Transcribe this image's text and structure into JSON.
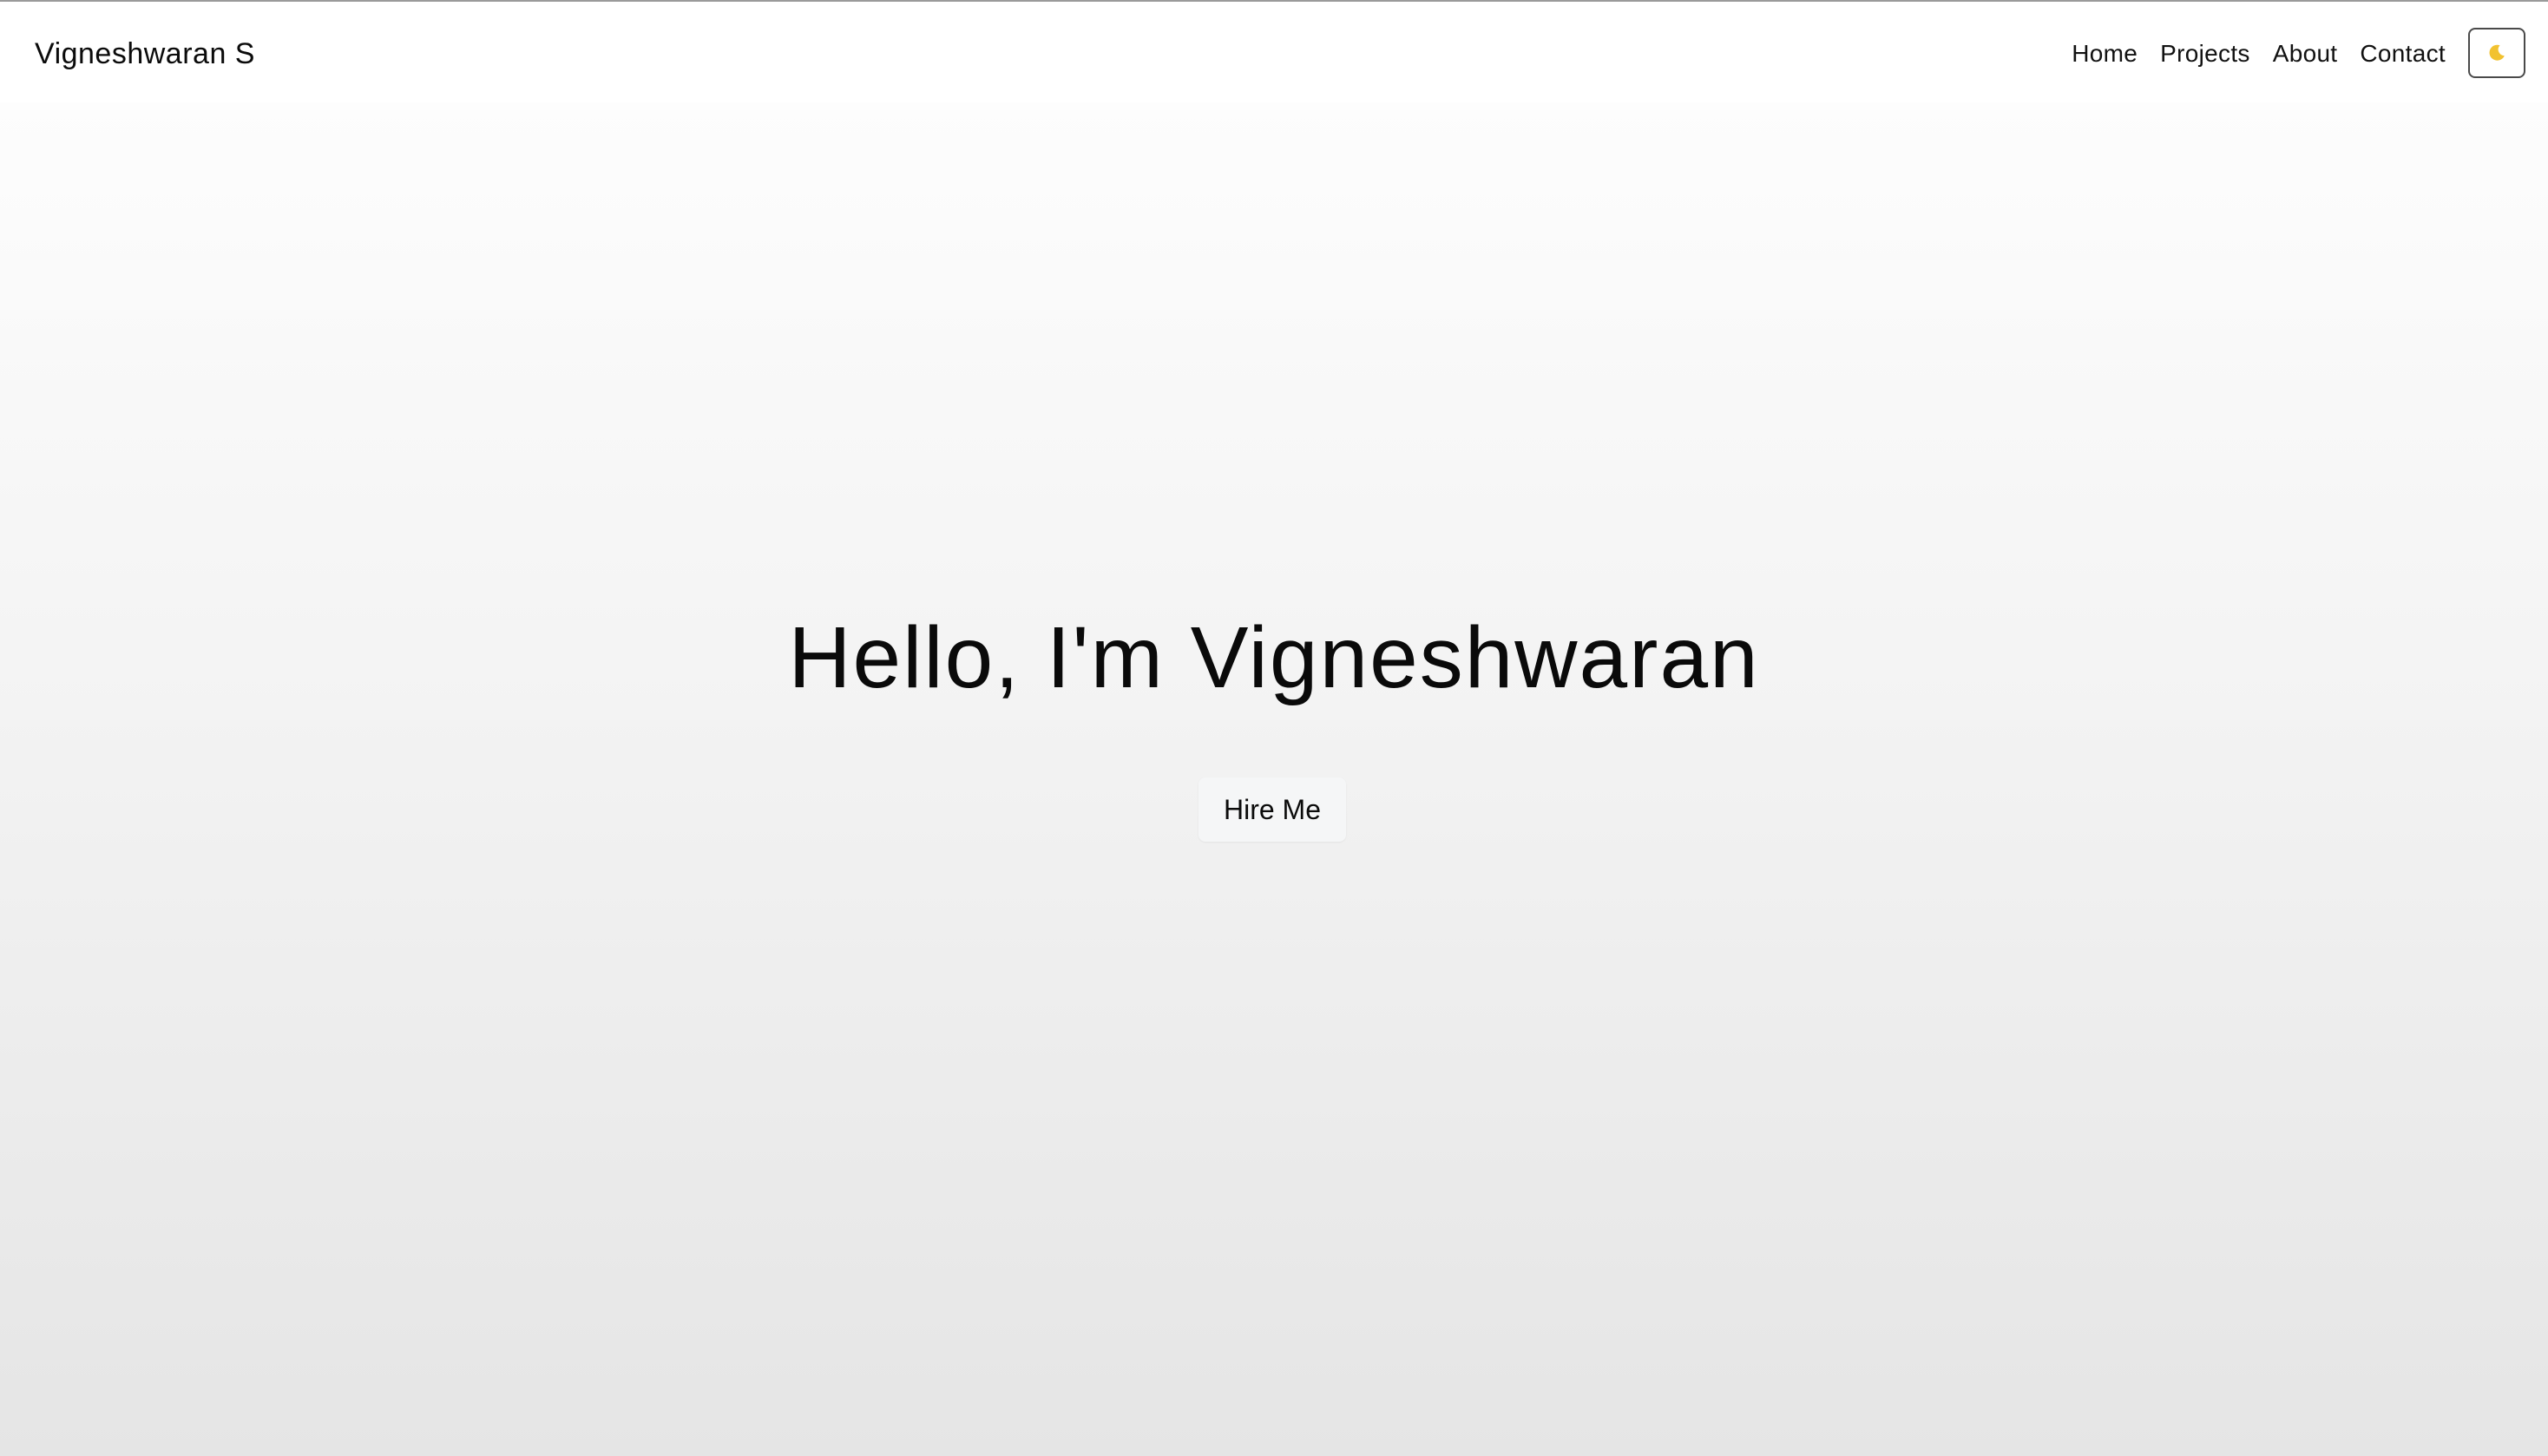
{
  "navbar": {
    "brand": "Vigneshwaran S",
    "links": [
      {
        "label": "Home"
      },
      {
        "label": "Projects"
      },
      {
        "label": "About"
      },
      {
        "label": "Contact"
      }
    ],
    "theme_toggle": {
      "icon": "moon-icon",
      "color": "#f2c230"
    }
  },
  "hero": {
    "title": "Hello, I'm Vigneshwaran",
    "cta_label": "Hire Me"
  },
  "colors": {
    "text": "#0b0b0b",
    "background_top": "#fdfdfd",
    "background_bottom": "#e5e5e5",
    "button_bg": "#f5f6f7"
  }
}
